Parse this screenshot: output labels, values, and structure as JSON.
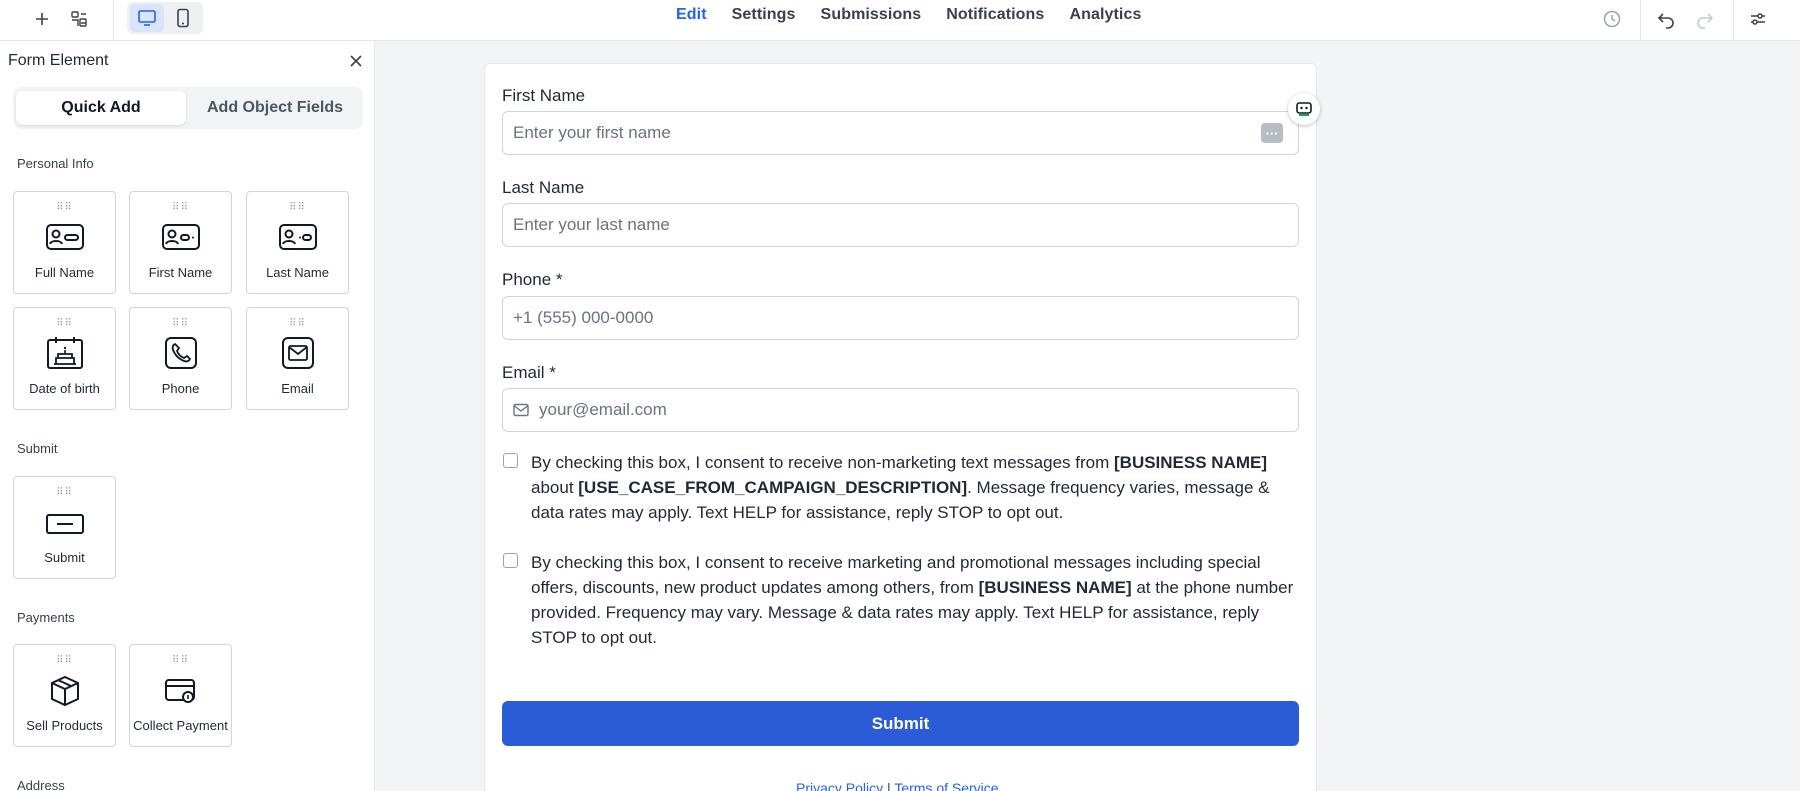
{
  "topbar": {
    "nav": [
      {
        "label": "Edit",
        "active": true
      },
      {
        "label": "Settings",
        "active": false
      },
      {
        "label": "Submissions",
        "active": false
      },
      {
        "label": "Notifications",
        "active": false
      },
      {
        "label": "Analytics",
        "active": false
      }
    ],
    "icons": [
      "plus-icon",
      "layout-icon",
      "desktop-icon",
      "mobile-icon",
      "history-icon",
      "undo-icon",
      "redo-icon",
      "settings-sliders-icon"
    ],
    "accent_color": "#2563eb"
  },
  "panel": {
    "title": "Form Element",
    "tabs": [
      {
        "label": "Quick Add",
        "active": true
      },
      {
        "label": "Add Object Fields",
        "active": false
      }
    ],
    "sections": {
      "personal_info": "Personal Info",
      "submit": "Submit",
      "payments": "Payments",
      "address": "Address"
    },
    "tiles": {
      "full_name": "Full Name",
      "first_name": "First Name",
      "last_name": "Last Name",
      "date_of_birth": "Date of birth",
      "phone": "Phone",
      "email": "Email",
      "submit": "Submit",
      "sell_products": "Sell Products",
      "collect_payment": "Collect Payment"
    }
  },
  "form": {
    "first_name": {
      "label": "First Name",
      "placeholder": "Enter your first name"
    },
    "last_name": {
      "label": "Last Name",
      "placeholder": "Enter your last name"
    },
    "phone": {
      "label": "Phone *",
      "placeholder": "+1 (555) 000-0000"
    },
    "email": {
      "label": "Email *",
      "placeholder": "your@email.com"
    },
    "consent1": {
      "a": "By checking this box, I consent to receive non-marketing text messages from ",
      "b": "[BUSINESS NAME]",
      "c": " about ",
      "d": "[USE_CASE_FROM_CAMPAIGN_DESCRIPTION]",
      "e": ". Message frequency varies, message & data rates may apply. Text HELP for assistance, reply STOP to opt out."
    },
    "consent2": {
      "a": "By checking this box, I consent to receive marketing and promotional messages including special offers, discounts, new product updates among others, from ",
      "b": "[BUSINESS NAME]",
      "c": " at the phone number provided. Frequency may vary. Message & data rates may apply. Text HELP for assistance, reply STOP to opt out."
    },
    "submit_label": "Submit",
    "privacy_label": "Privacy Policy",
    "separator": " | ",
    "terms_label": "Terms of Service",
    "submit_color": "#2b5bd7"
  }
}
